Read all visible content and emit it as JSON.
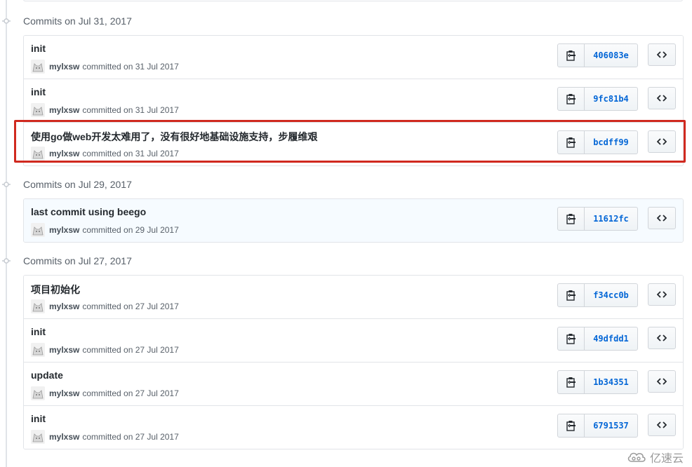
{
  "groups": [
    {
      "label": "Commits on Jul 31, 2017",
      "commits": [
        {
          "message": "init",
          "author": "mylxsw",
          "committed_text": "committed on 31 Jul 2017",
          "sha": "406083e"
        },
        {
          "message": "init",
          "author": "mylxsw",
          "committed_text": "committed on 31 Jul 2017",
          "sha": "9fc81b4"
        },
        {
          "message": "使用go做web开发太难用了，没有很好地基础设施支持，步履维艰",
          "author": "mylxsw",
          "committed_text": "committed on 31 Jul 2017",
          "sha": "bcdff99"
        }
      ]
    },
    {
      "label": "Commits on Jul 29, 2017",
      "commits": [
        {
          "message": "last commit using beego",
          "author": "mylxsw",
          "committed_text": "committed on 29 Jul 2017",
          "sha": "11612fc"
        }
      ]
    },
    {
      "label": "Commits on Jul 27, 2017",
      "commits": [
        {
          "message": "项目初始化",
          "author": "mylxsw",
          "committed_text": "committed on 27 Jul 2017",
          "sha": "f34cc0b"
        },
        {
          "message": "init",
          "author": "mylxsw",
          "committed_text": "committed on 27 Jul 2017",
          "sha": "49dfdd1"
        },
        {
          "message": "update",
          "author": "mylxsw",
          "committed_text": "committed on 27 Jul 2017",
          "sha": "1b34351"
        },
        {
          "message": "init",
          "author": "mylxsw",
          "committed_text": "committed on 27 Jul 2017",
          "sha": "6791537"
        }
      ]
    }
  ],
  "highlighted_commit_sha": "bcdff99",
  "hovered_commit_sha": "11612fc",
  "watermark": {
    "text": "亿速云",
    "icon": "cloud-logo"
  },
  "colors": {
    "annotation_red": "#d0291f",
    "sha_blue": "#0366d6",
    "border": "#e1e4e8"
  }
}
